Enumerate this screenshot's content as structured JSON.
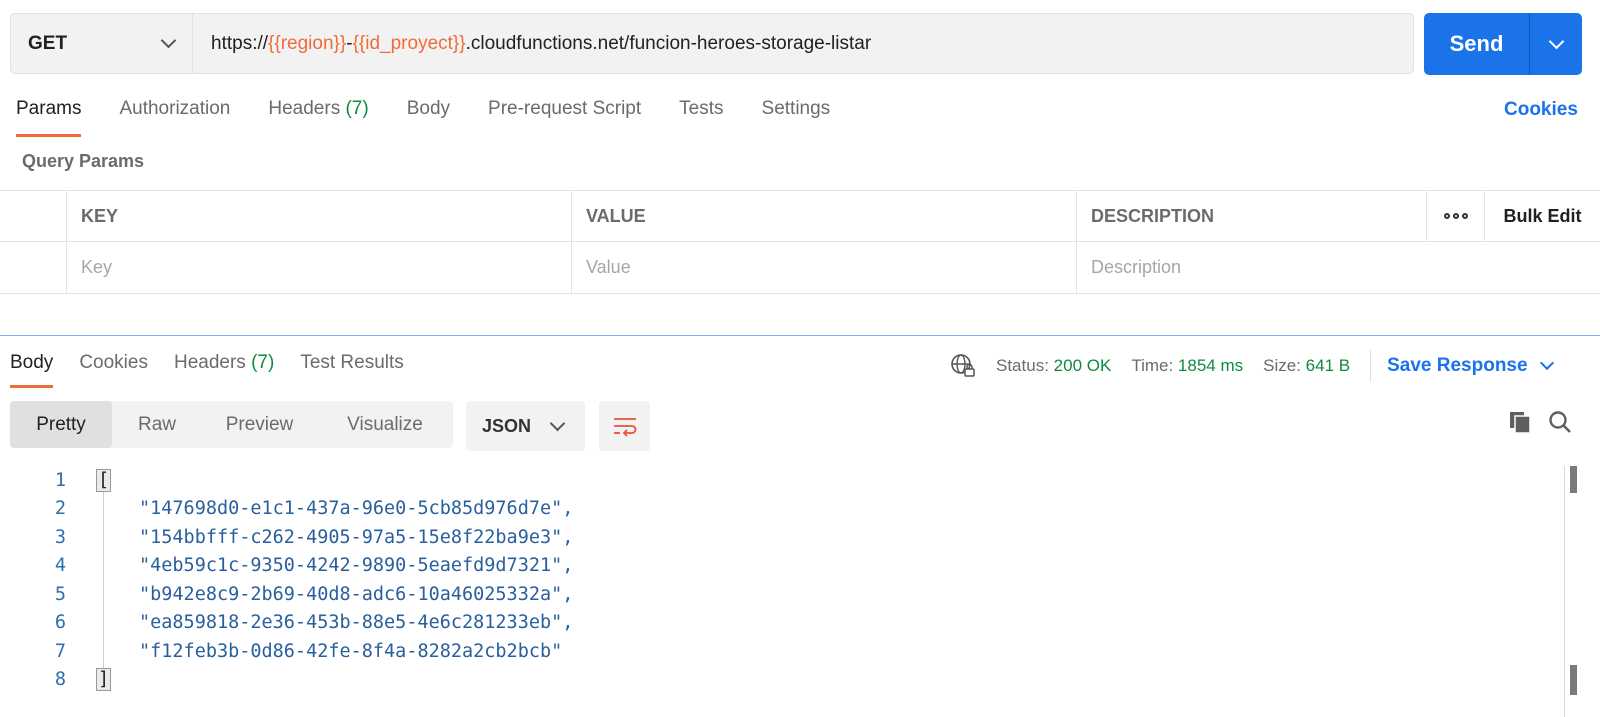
{
  "request": {
    "method": "GET",
    "url_parts": [
      {
        "text": "https://",
        "var": false
      },
      {
        "text": "{{region}}",
        "var": true
      },
      {
        "text": "-",
        "var": false
      },
      {
        "text": "{{id_proyect}}",
        "var": true
      },
      {
        "text": ".cloudfunctions.net/funcion-heroes-storage-listar",
        "var": false
      }
    ],
    "send_label": "Send"
  },
  "request_tabs": {
    "params": "Params",
    "authorization": "Authorization",
    "headers": "Headers",
    "headers_count": "(7)",
    "body": "Body",
    "prerequest": "Pre-request Script",
    "tests": "Tests",
    "settings": "Settings",
    "cookies": "Cookies"
  },
  "query_params": {
    "title": "Query Params",
    "columns": {
      "key": "KEY",
      "value": "VALUE",
      "description": "DESCRIPTION",
      "bulk_edit": "Bulk Edit"
    },
    "placeholders": {
      "key": "Key",
      "value": "Value",
      "description": "Description"
    }
  },
  "response_tabs": {
    "body": "Body",
    "cookies": "Cookies",
    "headers": "Headers",
    "headers_count": "(7)",
    "test_results": "Test Results"
  },
  "response_status": {
    "status_label": "Status:",
    "status_value": "200 OK",
    "time_label": "Time:",
    "time_value": "1854 ms",
    "size_label": "Size:",
    "size_value": "641 B",
    "save_response": "Save Response"
  },
  "view": {
    "pretty": "Pretty",
    "raw": "Raw",
    "preview": "Preview",
    "visualize": "Visualize",
    "format": "JSON"
  },
  "code_lines": [
    {
      "num": "1",
      "text": "["
    },
    {
      "num": "2",
      "text": "\"147698d0-e1c1-437a-96e0-5cb85d976d7e\","
    },
    {
      "num": "3",
      "text": "\"154bbfff-c262-4905-97a5-15e8f22ba9e3\","
    },
    {
      "num": "4",
      "text": "\"4eb59c1c-9350-4242-9890-5eaefd9d7321\","
    },
    {
      "num": "5",
      "text": "\"b942e8c9-2b69-40d8-adc6-10a46025332a\","
    },
    {
      "num": "6",
      "text": "\"ea859818-2e36-453b-88e5-4e6c281233eb\","
    },
    {
      "num": "7",
      "text": "\"f12feb3b-0d86-42fe-8f4a-8282a2cb2bcb\""
    },
    {
      "num": "8",
      "text": "]"
    }
  ],
  "colors": {
    "accent": "#f26b3a",
    "primary": "#1a73e8",
    "success": "#0f8a3e"
  }
}
